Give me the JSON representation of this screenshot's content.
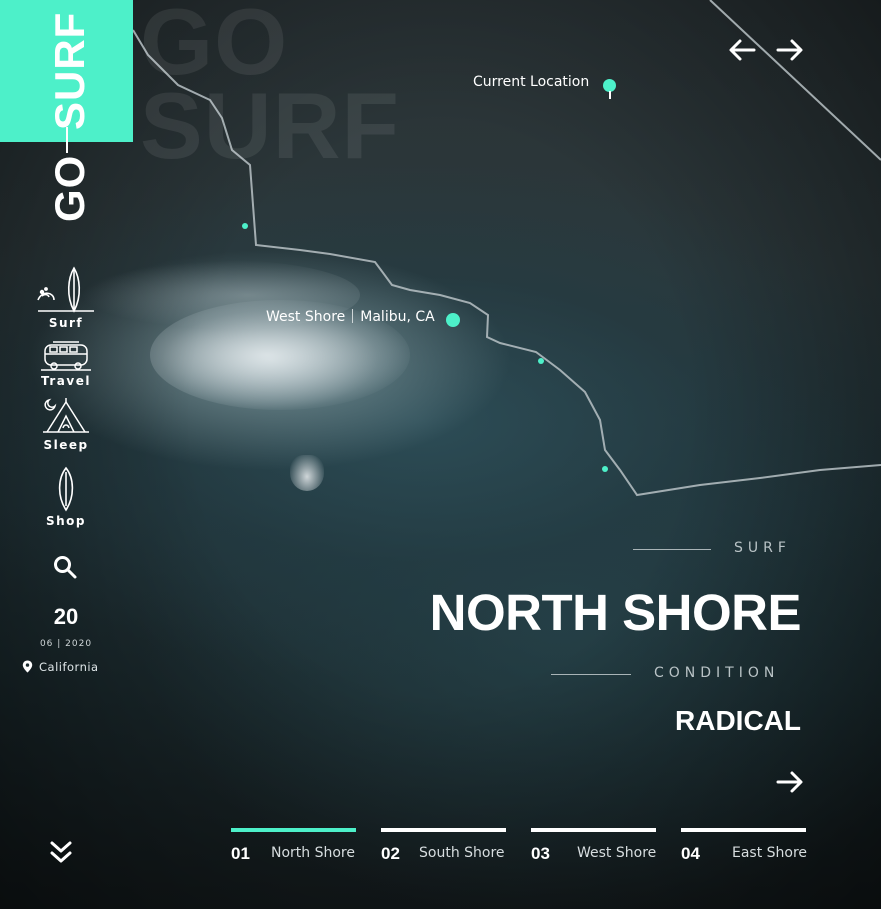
{
  "brand": {
    "go": "GO",
    "surf": "SURF",
    "ghost_top": "GO",
    "ghost_bottom": "SURF"
  },
  "nav": [
    {
      "label": "Surf",
      "icon": "surfboard-wave-icon"
    },
    {
      "label": "Travel",
      "icon": "van-icon"
    },
    {
      "label": "Sleep",
      "icon": "tent-icon"
    },
    {
      "label": "Shop",
      "icon": "surfboard-icon"
    }
  ],
  "search_icon": "search-icon",
  "date": {
    "day": "20",
    "month_year": "06 | 2020",
    "location": "California"
  },
  "map": {
    "current_location": "Current Location",
    "spot_name": "West Shore",
    "spot_place": "Malibu, CA"
  },
  "info": {
    "eyebrow": "SURF",
    "title": "NORTH SHORE",
    "condition_label": "CONDITION",
    "condition_value": "RADICAL"
  },
  "tabs": [
    {
      "num": "01",
      "name": "North Shore",
      "active": true
    },
    {
      "num": "02",
      "name": "South Shore",
      "active": false
    },
    {
      "num": "03",
      "name": "West Shore",
      "active": false
    },
    {
      "num": "04",
      "name": "East Shore",
      "active": false
    }
  ],
  "colors": {
    "accent": "#4df0c9",
    "text": "#ffffff",
    "muted": "#b9c3c6"
  }
}
